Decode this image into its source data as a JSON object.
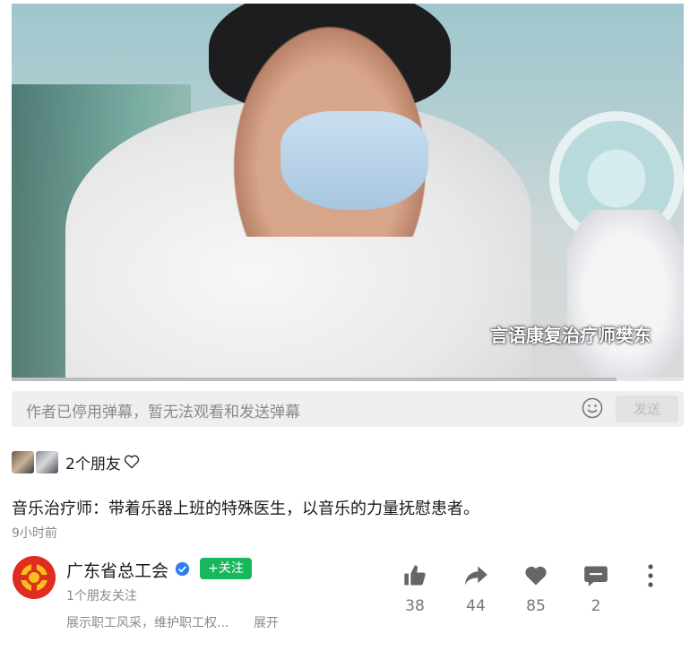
{
  "video": {
    "caption": "言语康复治疗师樊东",
    "progress": 0.9
  },
  "danmaku": {
    "placeholder_text": "作者已停用弹幕，暂无法观看和发送弹幕",
    "send_label": "发送"
  },
  "friends": {
    "label": "2个朋友"
  },
  "post": {
    "title": "音乐治疗师：带着乐器上班的特殊医生，以音乐的力量抚慰患者。",
    "time": "9小时前"
  },
  "author": {
    "name": "广东省总工会",
    "follow_label": "+关注",
    "followed_by": "1个朋友关注",
    "description": "展示职工风采，维护职工权...",
    "expand_label": "展开"
  },
  "actions": {
    "like_count": "38",
    "share_count": "44",
    "heart_count": "85",
    "comment_count": "2"
  },
  "colors": {
    "follow_green": "#17b85c",
    "verify_blue": "#2f7df6",
    "logo_red": "#e02d1f"
  }
}
